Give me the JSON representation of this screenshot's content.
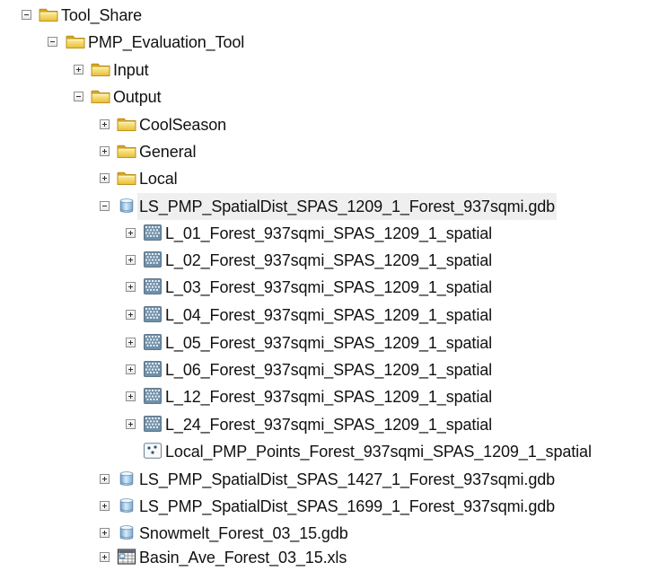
{
  "tree": {
    "root": {
      "label": "Tool_Share",
      "icon": "folder-icon",
      "state": "expanded"
    },
    "tool": {
      "label": "PMP_Evaluation_Tool",
      "icon": "folder-icon",
      "state": "expanded"
    },
    "input": {
      "label": "Input",
      "icon": "folder-icon",
      "state": "collapsed"
    },
    "output": {
      "label": "Output",
      "icon": "folder-icon",
      "state": "expanded"
    },
    "coolseason": {
      "label": "CoolSeason",
      "icon": "folder-icon",
      "state": "collapsed"
    },
    "general": {
      "label": "General",
      "icon": "folder-icon",
      "state": "collapsed"
    },
    "local": {
      "label": "Local",
      "icon": "folder-icon",
      "state": "collapsed"
    },
    "gdb_1209": {
      "label": "LS_PMP_SpatialDist_SPAS_1209_1_Forest_937sqmi.gdb",
      "icon": "geodatabase-icon",
      "state": "expanded"
    },
    "raster_01": {
      "label": "L_01_Forest_937sqmi_SPAS_1209_1_spatial",
      "icon": "raster-icon",
      "state": "collapsed"
    },
    "raster_02": {
      "label": "L_02_Forest_937sqmi_SPAS_1209_1_spatial",
      "icon": "raster-icon",
      "state": "collapsed"
    },
    "raster_03": {
      "label": "L_03_Forest_937sqmi_SPAS_1209_1_spatial",
      "icon": "raster-icon",
      "state": "collapsed"
    },
    "raster_04": {
      "label": "L_04_Forest_937sqmi_SPAS_1209_1_spatial",
      "icon": "raster-icon",
      "state": "collapsed"
    },
    "raster_05": {
      "label": "L_05_Forest_937sqmi_SPAS_1209_1_spatial",
      "icon": "raster-icon",
      "state": "collapsed"
    },
    "raster_06": {
      "label": "L_06_Forest_937sqmi_SPAS_1209_1_spatial",
      "icon": "raster-icon",
      "state": "collapsed"
    },
    "raster_12": {
      "label": "L_12_Forest_937sqmi_SPAS_1209_1_spatial",
      "icon": "raster-icon",
      "state": "collapsed"
    },
    "raster_24": {
      "label": "L_24_Forest_937sqmi_SPAS_1209_1_spatial",
      "icon": "raster-icon",
      "state": "collapsed"
    },
    "points": {
      "label": "Local_PMP_Points_Forest_937sqmi_SPAS_1209_1_spatial",
      "icon": "point-feature-class-icon"
    },
    "gdb_1427": {
      "label": "LS_PMP_SpatialDist_SPAS_1427_1_Forest_937sqmi.gdb",
      "icon": "geodatabase-icon",
      "state": "collapsed"
    },
    "gdb_1699": {
      "label": "LS_PMP_SpatialDist_SPAS_1699_1_Forest_937sqmi.gdb",
      "icon": "geodatabase-icon",
      "state": "collapsed"
    },
    "snowmelt": {
      "label": "Snowmelt_Forest_03_15.gdb",
      "icon": "geodatabase-icon",
      "state": "collapsed"
    },
    "basin": {
      "label": "Basin_Ave_Forest_03_15.xls",
      "icon": "spreadsheet-icon",
      "state": "collapsed"
    }
  }
}
